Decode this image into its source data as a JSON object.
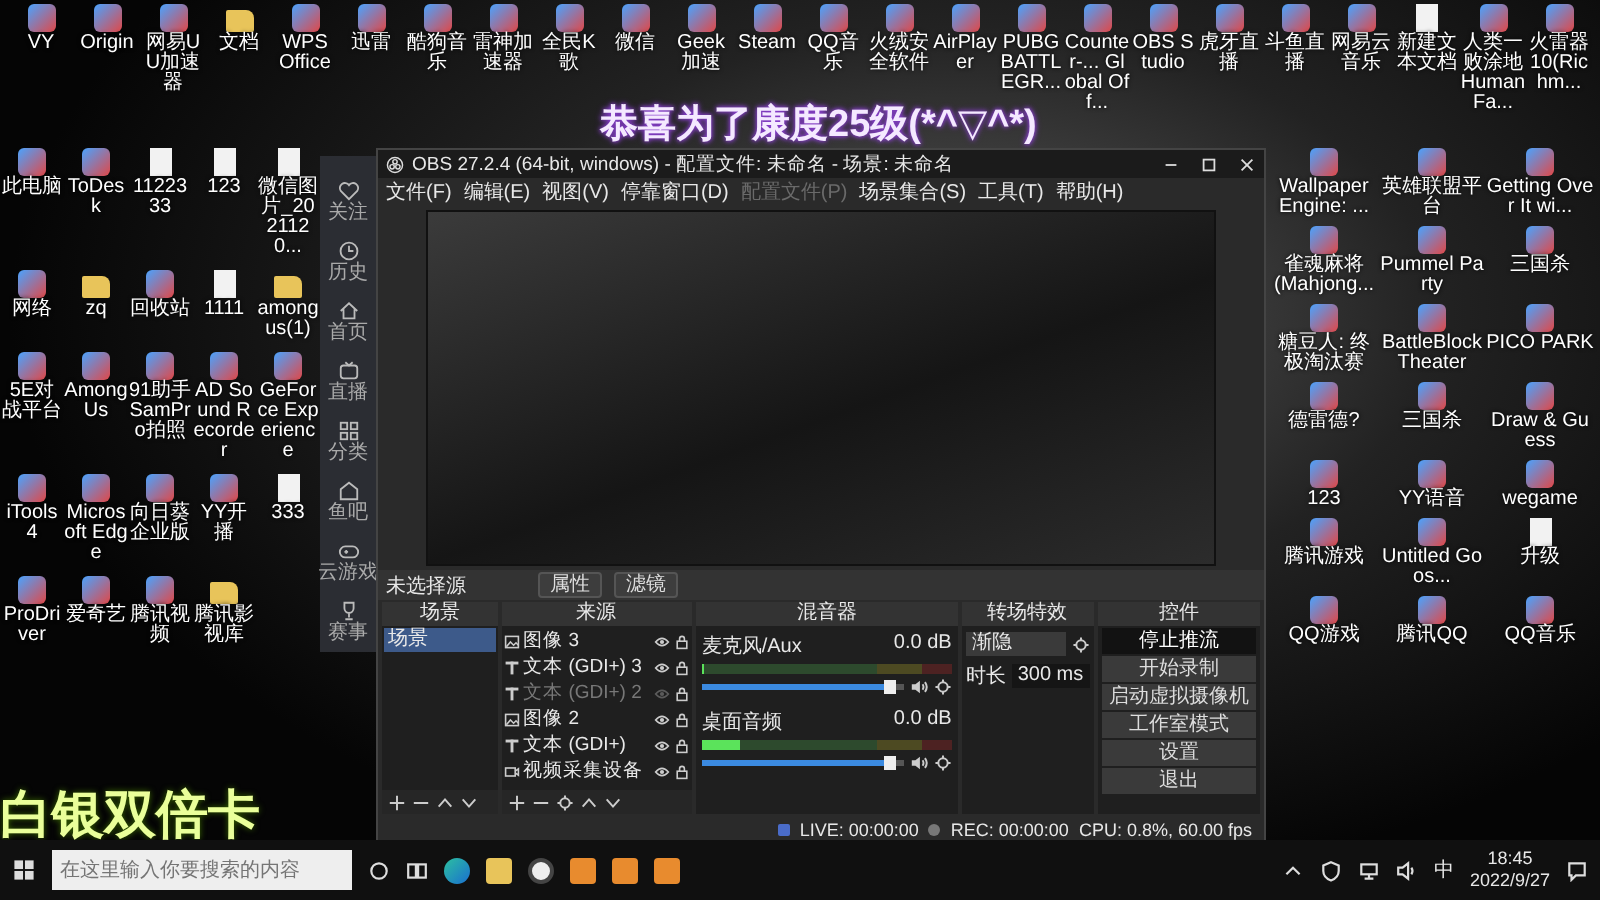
{
  "desktop": {
    "top_row": [
      {
        "label": "VY",
        "kind": "app"
      },
      {
        "label": "Origin",
        "kind": "app"
      },
      {
        "label": "网易UU加速器",
        "kind": "app"
      },
      {
        "label": "文档",
        "kind": "folder"
      },
      {
        "label": "WPS Office",
        "kind": "app"
      },
      {
        "label": "迅雷",
        "kind": "app"
      },
      {
        "label": "酷狗音乐",
        "kind": "app"
      },
      {
        "label": "雷神加速器",
        "kind": "app"
      },
      {
        "label": "全民K歌",
        "kind": "app"
      },
      {
        "label": "微信",
        "kind": "app"
      },
      {
        "label": "Geek加速",
        "kind": "app"
      },
      {
        "label": "Steam",
        "kind": "app"
      },
      {
        "label": "QQ音乐",
        "kind": "app"
      },
      {
        "label": "火绒安全软件",
        "kind": "app"
      },
      {
        "label": "AirPlayer",
        "kind": "app"
      },
      {
        "label": "PUBG BATTLEGR...",
        "kind": "app"
      },
      {
        "label": "Counter-... Global Off...",
        "kind": "app"
      },
      {
        "label": "OBS Studio",
        "kind": "app"
      },
      {
        "label": "虎牙直播",
        "kind": "app"
      },
      {
        "label": "斗鱼直播",
        "kind": "app"
      },
      {
        "label": "网易云音乐",
        "kind": "app"
      },
      {
        "label": "新建文本文档",
        "kind": "file"
      },
      {
        "label": "人类一败涂地 Human Fa...",
        "kind": "app"
      },
      {
        "label": "火雷器 10(Richm...",
        "kind": "app"
      }
    ],
    "caption": "恭喜为了康度25级(*^▽^*)",
    "left_icons": [
      {
        "label": "此电脑",
        "kind": "app"
      },
      {
        "label": "ToDesk",
        "kind": "app"
      },
      {
        "label": "1122333",
        "kind": "file"
      },
      {
        "label": "123",
        "kind": "file"
      },
      {
        "label": "微信图片_2021120...",
        "kind": "file"
      },
      {
        "label": "网络",
        "kind": "app"
      },
      {
        "label": "zq",
        "kind": "folder"
      },
      {
        "label": "回收站",
        "kind": "app"
      },
      {
        "label": "1111",
        "kind": "file"
      },
      {
        "label": "among us(1)",
        "kind": "folder"
      },
      {
        "label": "5E对战平台",
        "kind": "app"
      },
      {
        "label": "Among Us",
        "kind": "app"
      },
      {
        "label": "91助手 SamPro拍照",
        "kind": "app"
      },
      {
        "label": "AD Sound Recorder",
        "kind": "app"
      },
      {
        "label": "GeForce Experience",
        "kind": "app"
      },
      {
        "label": "iTools 4",
        "kind": "app"
      },
      {
        "label": "Microsoft Edge",
        "kind": "app"
      },
      {
        "label": "向日葵企业版",
        "kind": "app"
      },
      {
        "label": "YY开播",
        "kind": "app"
      },
      {
        "label": "333",
        "kind": "file"
      },
      {
        "label": "ProDriver",
        "kind": "app"
      },
      {
        "label": "爱奇艺",
        "kind": "app"
      },
      {
        "label": "腾讯视频",
        "kind": "app"
      },
      {
        "label": "腾讯影视库",
        "kind": "folder"
      }
    ],
    "bottom_caption": "白银双倍卡",
    "right_icons": [
      {
        "label": "Wallpaper Engine: ...",
        "kind": "app"
      },
      {
        "label": "英雄联盟平台",
        "kind": "app"
      },
      {
        "label": "Getting Over It wi...",
        "kind": "app"
      },
      {
        "label": "雀魂麻将 (Mahjong...",
        "kind": "app"
      },
      {
        "label": "Pummel Party",
        "kind": "app"
      },
      {
        "label": "三国杀",
        "kind": "app"
      },
      {
        "label": "糖豆人: 终极淘汰赛",
        "kind": "app"
      },
      {
        "label": "BattleBlock Theater",
        "kind": "app"
      },
      {
        "label": "PICO PARK",
        "kind": "app"
      },
      {
        "label": "德雷德?",
        "kind": "app"
      },
      {
        "label": "三国杀",
        "kind": "app"
      },
      {
        "label": "Draw & Guess",
        "kind": "app"
      },
      {
        "label": "123",
        "kind": "app"
      },
      {
        "label": "YY语音",
        "kind": "app"
      },
      {
        "label": "wegame",
        "kind": "app"
      },
      {
        "label": "腾讯游戏",
        "kind": "app"
      },
      {
        "label": "Untitled Goos...",
        "kind": "app"
      },
      {
        "label": "升级",
        "kind": "file"
      },
      {
        "label": "QQ游戏",
        "kind": "app"
      },
      {
        "label": "腾讯QQ",
        "kind": "app"
      },
      {
        "label": "QQ音乐",
        "kind": "app"
      }
    ]
  },
  "browser_sidebar": [
    {
      "label": "关注",
      "kind": "heart"
    },
    {
      "label": "历史",
      "kind": "clock"
    },
    {
      "label": "首页",
      "kind": "home"
    },
    {
      "label": "直播",
      "kind": "tv"
    },
    {
      "label": "分类",
      "kind": "grid"
    },
    {
      "label": "鱼吧",
      "kind": "post"
    },
    {
      "label": "云游戏",
      "kind": "gamepad"
    },
    {
      "label": "赛事",
      "kind": "trophy"
    }
  ],
  "obs": {
    "title": "OBS 27.2.4 (64-bit, windows) - 配置文件: 未命名 - 场景: 未命名",
    "menu": [
      {
        "label": "文件(F)",
        "disabled": false
      },
      {
        "label": "编辑(E)",
        "disabled": false
      },
      {
        "label": "视图(V)",
        "disabled": false
      },
      {
        "label": "停靠窗口(D)",
        "disabled": false
      },
      {
        "label": "配置文件(P)",
        "disabled": true
      },
      {
        "label": "场景集合(S)",
        "disabled": false
      },
      {
        "label": "工具(T)",
        "disabled": false
      },
      {
        "label": "帮助(H)",
        "disabled": false
      }
    ],
    "source_toolbar": {
      "label": "未选择源",
      "buttons": [
        "属性",
        "滤镜"
      ]
    },
    "docks": {
      "scenes": "场景",
      "sources": "来源",
      "mixer": "混音器",
      "transitions": "转场特效",
      "controls": "控件"
    },
    "scenes": [
      {
        "name": "场景",
        "selected": true
      }
    ],
    "sources": [
      {
        "name": "图像 3",
        "kind": "image",
        "visible": true
      },
      {
        "name": "文本 (GDI+) 3",
        "kind": "text",
        "visible": true
      },
      {
        "name": "文本 (GDI+) 2",
        "kind": "text",
        "visible": false
      },
      {
        "name": "图像 2",
        "kind": "image",
        "visible": true
      },
      {
        "name": "文本 (GDI+)",
        "kind": "text",
        "visible": true
      },
      {
        "name": "视频采集设备",
        "kind": "camera",
        "visible": true
      }
    ],
    "mixer": [
      {
        "name": "麦克风/Aux",
        "reading": "0.0 dB",
        "meter": {
          "level": 0
        },
        "volume": {
          "level": 0.93
        }
      },
      {
        "name": "桌面音频",
        "reading": "0.0 dB",
        "meter": {
          "level": 0.15
        },
        "volume": {
          "level": 0.93
        }
      }
    ],
    "transition": {
      "value": "渐隐",
      "duration_label": "时长",
      "duration": "300 ms"
    },
    "controls": [
      {
        "label": "停止推流",
        "active": true
      },
      {
        "label": "开始录制",
        "active": false
      },
      {
        "label": "启动虚拟摄像机",
        "active": false
      },
      {
        "label": "工作室模式",
        "active": false
      },
      {
        "label": "设置",
        "active": false
      },
      {
        "label": "退出",
        "active": false
      }
    ],
    "status": {
      "live": "LIVE: 00:00:00",
      "rec": "REC: 00:00:00",
      "cpu": "CPU: 0.8%, 60.00 fps"
    }
  },
  "taskbar": {
    "search": {
      "placeholder": "在这里输入你要搜索的内容"
    },
    "apps": [
      {
        "kind": "edge"
      },
      {
        "kind": "folder"
      },
      {
        "kind": "obs"
      },
      {
        "kind": "app"
      },
      {
        "kind": "app"
      },
      {
        "kind": "app"
      }
    ],
    "ime": "中",
    "time": "18:45",
    "date": "2022/9/27"
  }
}
